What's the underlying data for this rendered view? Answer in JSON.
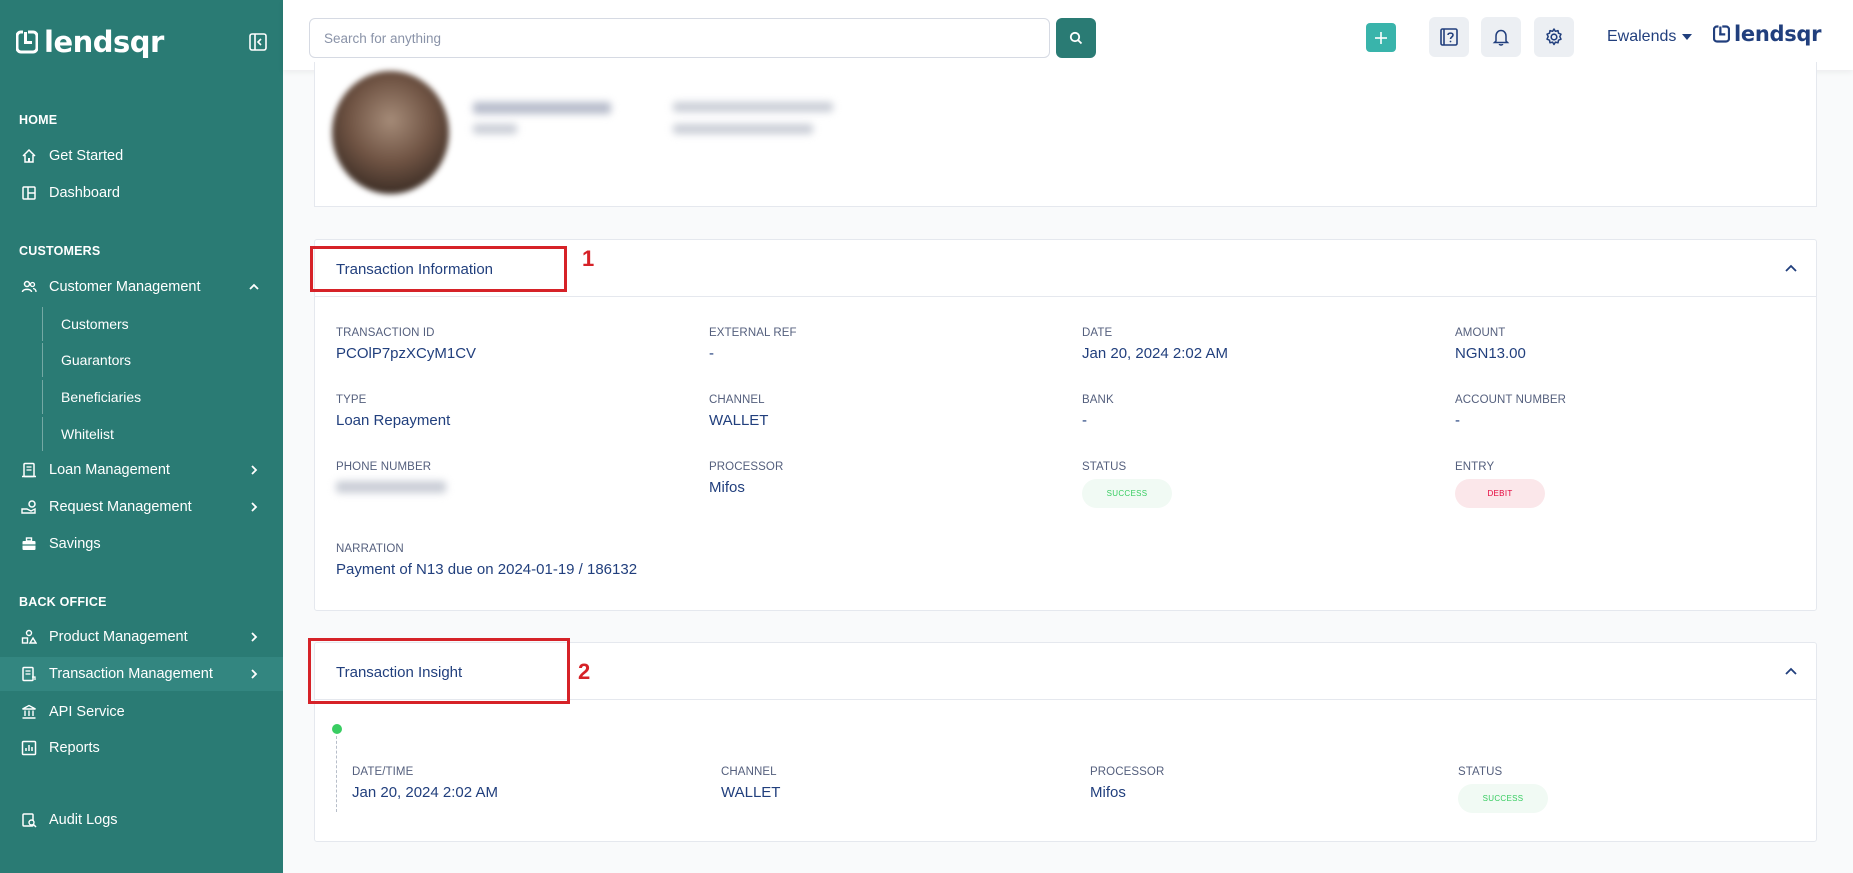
{
  "sidebar": {
    "brand": "lendsqr",
    "sections": {
      "home": "HOME",
      "customers": "CUSTOMERS",
      "back_office": "BACK OFFICE"
    },
    "items": {
      "get_started": "Get Started",
      "dashboard": "Dashboard",
      "customer_management": "Customer Management",
      "customers": "Customers",
      "guarantors": "Guarantors",
      "beneficiaries": "Beneficiaries",
      "whitelist": "Whitelist",
      "loan_management": "Loan Management",
      "request_management": "Request Management",
      "savings": "Savings",
      "product_management": "Product Management",
      "transaction_management": "Transaction Management",
      "api_service": "API Service",
      "reports": "Reports",
      "audit_logs": "Audit Logs"
    },
    "active_item": "transaction_management"
  },
  "topbar": {
    "search_placeholder": "Search for anything",
    "user_name": "Ewalends",
    "brand": "lendsqr"
  },
  "transaction_information": {
    "title": "Transaction Information",
    "annotation": "1",
    "fields": {
      "transaction_id": {
        "label": "TRANSACTION ID",
        "value": "PCOlP7pzXCyM1CV"
      },
      "external_ref": {
        "label": "EXTERNAL REF",
        "value": "-"
      },
      "date": {
        "label": "DATE",
        "value": "Jan 20, 2024 2:02 AM"
      },
      "amount": {
        "label": "AMOUNT",
        "value": "NGN13.00"
      },
      "type": {
        "label": "TYPE",
        "value": "Loan Repayment"
      },
      "channel": {
        "label": "CHANNEL",
        "value": "WALLET"
      },
      "bank": {
        "label": "BANK",
        "value": "-"
      },
      "account_number": {
        "label": "ACCOUNT NUMBER",
        "value": "-"
      },
      "phone_number": {
        "label": "PHONE NUMBER"
      },
      "processor": {
        "label": "PROCESSOR",
        "value": "Mifos"
      },
      "status": {
        "label": "STATUS",
        "value": "SUCCESS"
      },
      "entry": {
        "label": "ENTRY",
        "value": "DEBIT"
      },
      "narration": {
        "label": "NARRATION",
        "value": "Payment of N13 due on 2024-01-19 / 186132"
      }
    }
  },
  "transaction_insight": {
    "title": "Transaction Insight",
    "annotation": "2",
    "entry": {
      "datetime": {
        "label": "DATE/TIME",
        "value": "Jan 20, 2024 2:02 AM"
      },
      "channel": {
        "label": "CHANNEL",
        "value": "WALLET"
      },
      "processor": {
        "label": "PROCESSOR",
        "value": "Mifos"
      },
      "status": {
        "label": "STATUS",
        "value": "SUCCESS"
      }
    }
  },
  "colors": {
    "sidebar_bg": "#2a7b74",
    "primary_text": "#213f7d",
    "highlight_red": "#d62228",
    "success_green": "#39cd62",
    "debit_red": "#e4033b"
  },
  "icons": [
    "home-icon",
    "dashboard-icon",
    "users-icon",
    "loan-icon",
    "request-icon",
    "savings-icon",
    "product-icon",
    "transaction-icon",
    "api-icon",
    "reports-icon",
    "audit-icon",
    "search-icon",
    "plus-icon",
    "help-icon",
    "bell-icon",
    "gear-icon",
    "chevron-up-icon",
    "chevron-right-icon",
    "collapse-sidebar-icon"
  ]
}
